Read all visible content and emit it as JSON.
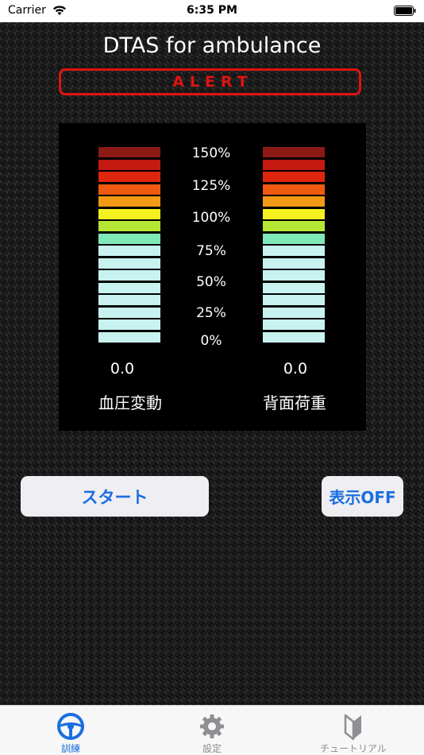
{
  "status_bar": {
    "carrier": "Carrier",
    "time": "6:35 PM",
    "wifi_icon": "wifi-icon",
    "battery_icon": "battery-full-icon"
  },
  "header": {
    "title": "DTAS for ambulance",
    "alert_label": "ALERT",
    "alert_color": "#e01212"
  },
  "meters": {
    "percent_labels": [
      "150%",
      "125%",
      "100%",
      "75%",
      "50%",
      "25%",
      "0%"
    ],
    "bar_colors": [
      "#8b1a14",
      "#c41a12",
      "#e0250f",
      "#f05a10",
      "#f39a16",
      "#f5f020",
      "#b5e634",
      "#7fe8b8",
      "#c8f2f0",
      "#c8f2f0",
      "#c8f2f0",
      "#c8f2f0",
      "#c8f2f0",
      "#c8f2f0",
      "#c8f2f0",
      "#c8f2f0"
    ],
    "left": {
      "value": "0.0",
      "name": "血圧変動"
    },
    "right": {
      "value": "0.0",
      "name": "背面荷重"
    }
  },
  "buttons": {
    "start_label": "スタート",
    "display_label": "表示OFF",
    "accent_color": "#1a6ee0"
  },
  "tab_bar": {
    "tabs": [
      {
        "label": "訓練",
        "icon": "steering-wheel-icon",
        "selected": true
      },
      {
        "label": "設定",
        "icon": "gear-icon",
        "selected": false
      },
      {
        "label": "チュートリアル",
        "icon": "beginner-mark-icon",
        "selected": false
      }
    ]
  }
}
